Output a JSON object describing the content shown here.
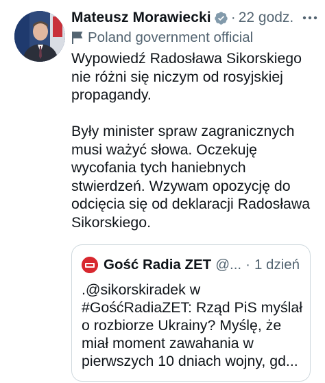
{
  "tweet": {
    "author_name": "Mateusz Morawiecki",
    "separator": "·",
    "time": "22 godz.",
    "label": "Poland government official",
    "text": "Wypowiedź Radosława Sikorskiego\nnie różni się niczym od rosyjskiej\npropagandy.\n\nByły minister spraw zagranicznych\nmusi ważyć słowa. Oczekuję\nwycofania tych haniebnych\nstwierdzeń. Wzywam opozycję do\nodcięcia się od deklaracji Radosława\nSikorskiego."
  },
  "quote": {
    "author_name": "Gość Radia ZET",
    "handle": "@...",
    "separator": "·",
    "time": "1 dzień",
    "text": ".@sikorskiradek w\n#GośćRadiaZET: Rząd PiS myślał\no rozbiorze Ukrainy? Myślę, że\nmiał moment zawahania w\npierwszych 10 dniach wojny, gd..."
  },
  "colors": {
    "text": "#0f1419",
    "secondary": "#536471",
    "verified_badge": "#829aab",
    "quote_border": "#cfd9de",
    "quote_avatar": "#d8282f"
  },
  "icons": [
    "verified-badge-icon",
    "flag-icon",
    "more-options-icon"
  ]
}
